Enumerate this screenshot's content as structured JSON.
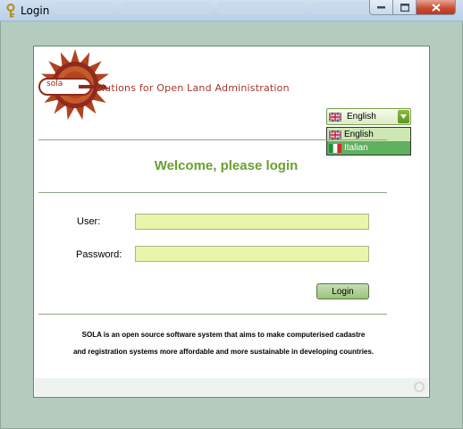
{
  "window": {
    "title": "Login",
    "icon": "key-icon",
    "controls": {
      "minimize": "minimize-icon",
      "maximize": "maximize-icon",
      "close": "close-icon"
    }
  },
  "logo": {
    "letters": "sola",
    "tagline": "olutions for Open Land Administration"
  },
  "language": {
    "selected": "English",
    "options": [
      {
        "label": "English",
        "flag": "uk-flag-icon",
        "highlighted": false
      },
      {
        "label": "Italian",
        "flag": "italy-flag-icon",
        "highlighted": true
      }
    ]
  },
  "welcome": "Welcome, please login",
  "form": {
    "user_label": "User:",
    "user_value": "",
    "password_label": "Password:",
    "password_value": "",
    "login_label": "Login"
  },
  "about": {
    "line1": "SOLA is an open source software system that aims to make computerised cadastre",
    "line2": "and registration systems more affordable and more sustainable in developing countries."
  },
  "colors": {
    "accent_green": "#6aa031",
    "input_fill": "#e8f5aa",
    "frame": "#b3ccbd",
    "tagline": "#a8352a"
  }
}
